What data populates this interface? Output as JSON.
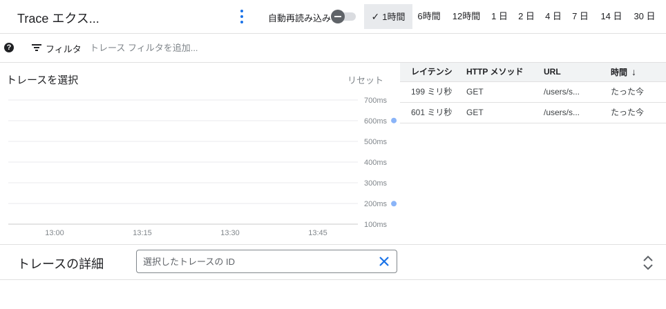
{
  "header": {
    "title": "Trace エクス...",
    "auto_reload_label": "自動再読み込み",
    "auto_reload_on": false,
    "time_ranges": [
      "1時間",
      "6時間",
      "12時間",
      "1 日",
      "2 日",
      "4 日",
      "7 日",
      "14 日",
      "30 日"
    ],
    "selected_range": "1時間"
  },
  "filter": {
    "label": "フィルタ",
    "placeholder": "トレース フィルタを追加..."
  },
  "chart_panel": {
    "title": "トレースを選択",
    "reset_label": "リセット"
  },
  "chart_data": {
    "type": "scatter",
    "title": "",
    "xlabel": "",
    "ylabel": "",
    "x_ticks": [
      "13:00",
      "13:15",
      "13:30",
      "13:45"
    ],
    "y_ticks": [
      "100ms",
      "200ms",
      "300ms",
      "400ms",
      "500ms",
      "600ms",
      "700ms"
    ],
    "ylim": [
      100,
      700
    ],
    "grid": true,
    "point_color": "#8ab4f8",
    "series": [
      {
        "points": [
          {
            "x": "13:58",
            "y": 601
          },
          {
            "x": "13:58",
            "y": 199
          }
        ]
      }
    ]
  },
  "table": {
    "columns": [
      "レイテンシ",
      "HTTP メソッド",
      "URL",
      "時間"
    ],
    "rows": [
      [
        "199 ミリ秒",
        "GET",
        "/users/s...",
        "たった今"
      ],
      [
        "601 ミリ秒",
        "GET",
        "/users/s...",
        "たった今"
      ]
    ]
  },
  "details": {
    "title": "トレースの詳細",
    "id_placeholder": "選択したトレースの ID"
  },
  "colors": {
    "accent": "#1a73e8",
    "selected_range_bg": "#e8eaed",
    "table_header_bg": "#f1f3f4"
  }
}
